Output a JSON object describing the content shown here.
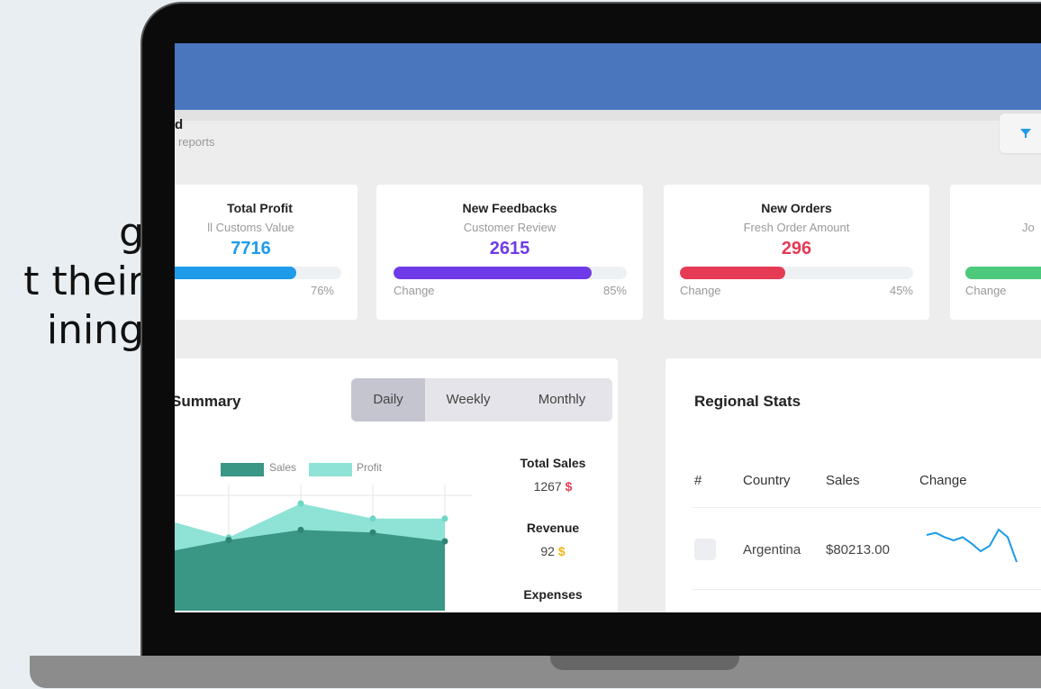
{
  "side_text": [
    "g",
    "t their",
    "ining"
  ],
  "dashboard": {
    "title": "d",
    "subtitle": "reports",
    "filter_icon": "filter-icon"
  },
  "stat_cards": [
    {
      "title": "Total Profit",
      "subtitle": "ll Customs Value",
      "value": "7716",
      "color": "#1e9be9",
      "progress": 0.76,
      "left_label": "",
      "right_label": "76%"
    },
    {
      "title": "New Feedbacks",
      "subtitle": "Customer Review",
      "value": "2615",
      "color": "#6f3be8",
      "progress": 0.85,
      "left_label": "Change",
      "right_label": "85%"
    },
    {
      "title": "New Orders",
      "subtitle": "Fresh Order Amount",
      "value": "296",
      "color": "#e53b55",
      "progress": 0.45,
      "left_label": "Change",
      "right_label": "45%"
    },
    {
      "title": "",
      "subtitle": "Jo",
      "value": "",
      "color": "#4cc97a",
      "left_label": "Change",
      "right_label": ""
    }
  ],
  "summary": {
    "title": "Summary",
    "tabs": [
      "Daily",
      "Weekly",
      "Monthly"
    ],
    "active_tab": "Daily",
    "legend": [
      {
        "name": "Sales",
        "color": "#3a9685"
      },
      {
        "name": "Profit",
        "color": "#8ee3d6"
      }
    ],
    "metrics": [
      {
        "label": "Total Sales",
        "value": "1267",
        "currency": "$",
        "currency_color": "red"
      },
      {
        "label": "Revenue",
        "value": "92",
        "currency": "$",
        "currency_color": "yellow"
      },
      {
        "label": "Expenses"
      }
    ]
  },
  "chart_data": {
    "type": "area",
    "title": "",
    "xlabel": "",
    "ylabel": "",
    "series": [
      {
        "name": "Sales",
        "values": [
          45,
          56,
          64,
          62,
          55
        ],
        "color": "#3a9685"
      },
      {
        "name": "Profit",
        "values": [
          74,
          58,
          85,
          73,
          73
        ],
        "color": "#8ee3d6"
      }
    ],
    "ylim": [
      0,
      100
    ],
    "grid": true,
    "legend_position": "top"
  },
  "regional": {
    "title": "Regional Stats",
    "headers": [
      "#",
      "Country",
      "Sales",
      "Change"
    ],
    "rows": [
      {
        "country": "Argentina",
        "sales": "$80213.00",
        "trend": [
          30,
          32,
          28,
          25,
          28,
          22,
          15,
          20,
          35,
          28,
          5
        ]
      }
    ]
  }
}
